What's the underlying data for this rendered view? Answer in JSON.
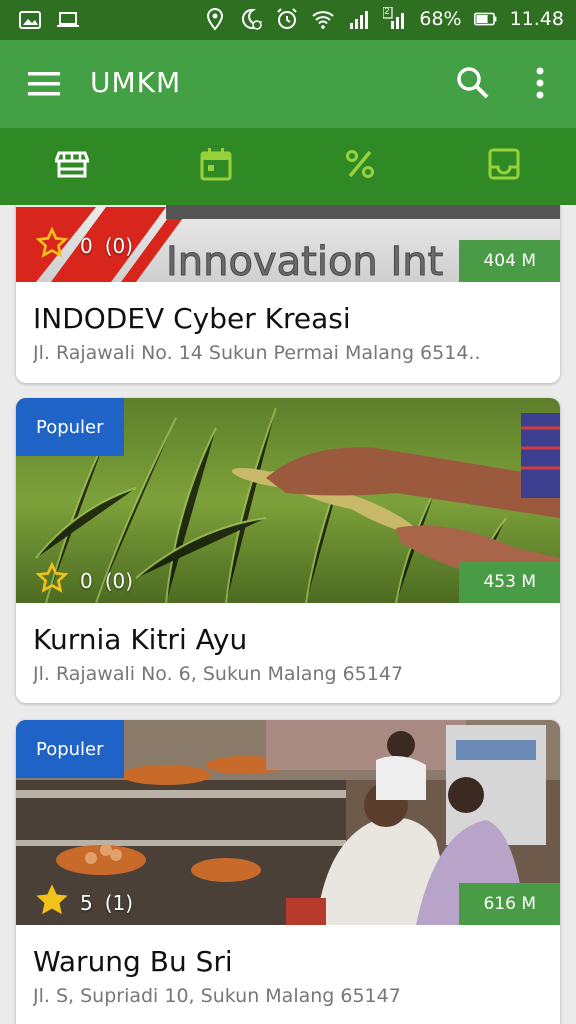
{
  "status_bar": {
    "battery": "68%",
    "time": "11.48",
    "sim2": "2"
  },
  "app_bar": {
    "title": "UMKM"
  },
  "tabs": [
    {
      "icon": "store-icon"
    },
    {
      "icon": "calendar-icon"
    },
    {
      "icon": "percent-icon"
    },
    {
      "icon": "inbox-icon"
    }
  ],
  "items": [
    {
      "name": "INDODEV Cyber Kreasi",
      "address": "Jl. Rajawali No. 14 Sukun Permai Malang 6514..",
      "rating": "0",
      "rating_count": "(0)",
      "distance": "404 M",
      "logo_text": "Innovation Int",
      "star": "outline"
    },
    {
      "badge": "Populer",
      "name": "Kurnia Kitri Ayu",
      "address": "Jl. Rajawali No. 6, Sukun Malang 65147",
      "rating": "0",
      "rating_count": "(0)",
      "distance": "453 M",
      "star": "outline"
    },
    {
      "badge": "Populer",
      "name": "Warung Bu Sri",
      "address": "Jl. S, Supriadi 10, Sukun Malang 65147",
      "rating": "5",
      "rating_count": "(1)",
      "distance": "616 M",
      "star": "filled"
    }
  ],
  "colors": {
    "status_bar": "#2e6f22",
    "app_bar": "#44a044",
    "tab_bar": "#2f8a26",
    "badge": "#1f63c6",
    "distance": "#4a9b46",
    "star": "#f2c21b"
  }
}
